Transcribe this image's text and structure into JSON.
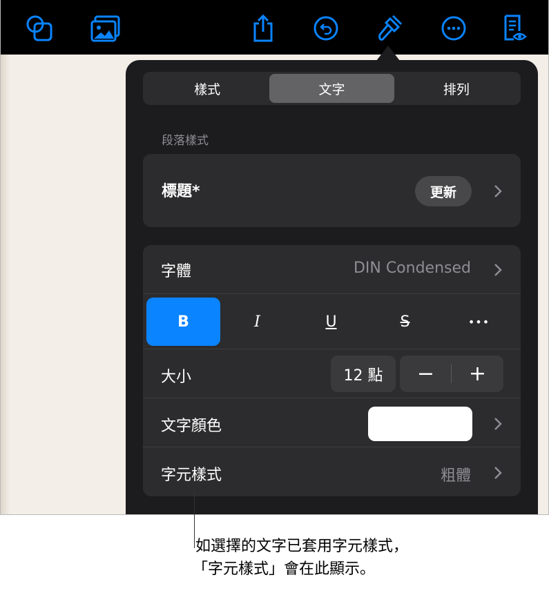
{
  "toolbar": {
    "icons": [
      "shapes-icon",
      "media-icon",
      "share-icon",
      "undo-icon",
      "format-paintbrush-icon",
      "more-icon",
      "reading-view-icon"
    ],
    "accent": "#0a84ff"
  },
  "popover": {
    "tabs": [
      {
        "label": "樣式",
        "active": false
      },
      {
        "label": "文字",
        "active": true
      },
      {
        "label": "排列",
        "active": false
      }
    ],
    "paragraph_style_header": "段落樣式",
    "paragraph_style": {
      "name": "標題*",
      "update_label": "更新"
    },
    "font_row": {
      "label": "字體",
      "value": "DIN Condensed"
    },
    "format_buttons": {
      "bold": "B",
      "italic": "I",
      "underline": "U",
      "strikethrough": "S",
      "more": "•••"
    },
    "size_row": {
      "label": "大小",
      "value": "12 點",
      "minus": "−",
      "plus": "+"
    },
    "text_color_row": {
      "label": "文字顏色",
      "color": "#ffffff"
    },
    "char_style_row": {
      "label": "字元樣式",
      "value": "粗體"
    }
  },
  "callout": {
    "line1": "如選擇的文字已套用字元樣式，",
    "line2": "「字元樣式」會在此顯示。"
  }
}
